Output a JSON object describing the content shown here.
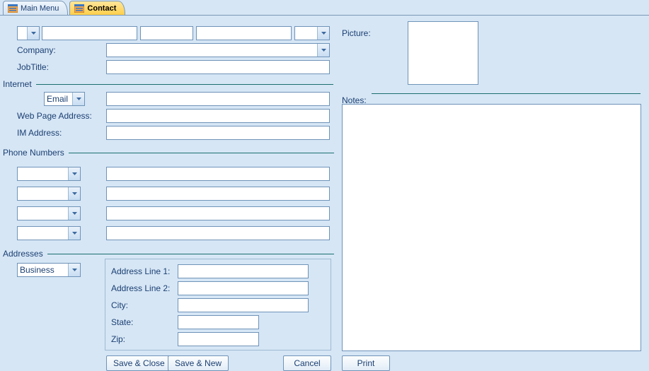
{
  "tabs": [
    {
      "label": "Main Menu",
      "active": false
    },
    {
      "label": "Contact",
      "active": true
    }
  ],
  "labels": {
    "company": "Company:",
    "jobtitle": "JobTitle:",
    "internet": "Internet",
    "webpage": "Web Page Address:",
    "im": "IM Address:",
    "phone": "Phone Numbers",
    "addresses": "Addresses",
    "addr1": "Address Line 1:",
    "addr2": "Address Line 2:",
    "city": "City:",
    "state": "State:",
    "zip": "Zip:",
    "picture": "Picture:",
    "notes": "Notes:"
  },
  "combos": {
    "prefix": "",
    "suffix": "",
    "company": "",
    "email": "Email",
    "phone1": "",
    "phone2": "",
    "phone3": "",
    "phone4": "",
    "addrtype": "Business"
  },
  "fields": {
    "first": "",
    "middle": "",
    "last": "",
    "jobtitle": "",
    "emailval": "",
    "webpage": "",
    "im": "",
    "phone1": "",
    "phone2": "",
    "phone3": "",
    "phone4": "",
    "addr1": "",
    "addr2": "",
    "city": "",
    "state": "",
    "zip": "",
    "notes": ""
  },
  "buttons": {
    "saveclose": "Save & Close",
    "savenew": "Save & New",
    "cancel": "Cancel",
    "print": "Print"
  }
}
